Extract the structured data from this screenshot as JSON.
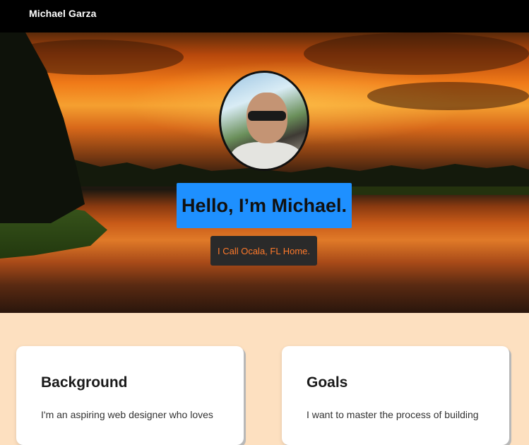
{
  "nav": {
    "brand": "Michael Garza"
  },
  "hero": {
    "heading": "Hello, I’m Michael.",
    "tagline": "I Call Ocala, FL Home."
  },
  "cards": [
    {
      "title": "Background",
      "text": "I'm an aspiring web designer who loves"
    },
    {
      "title": "Goals",
      "text": "I want to master the process of building"
    }
  ],
  "colors": {
    "navbar": "#000000",
    "heading_bg": "#1e90ff",
    "tagline_bg": "#2a2a2a",
    "tagline_text": "#ff7a2a",
    "page_bg": "#fde0c0"
  }
}
